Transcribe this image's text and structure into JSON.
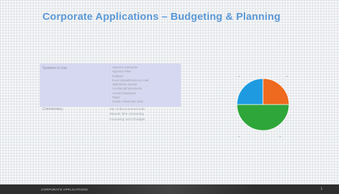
{
  "slide": {
    "title": "Corporate Applications – Budgeting & Planning",
    "table": {
      "row1": {
        "label": "Systems in Use",
        "items": [
          "Hyperion Enterprise",
          "Hyperion Pillar",
          "Essbase",
          "Excel spreadsheets & e-mail",
          "Wall-Street Journal",
          "Acrobat pdf documents",
          "Access Databases",
          "Paper",
          "Oracle e-Business Suite"
        ]
      },
      "row2": {
        "label": "Commentary",
        "lines": [
          "Mix of disconnected tools",
          "Manual, time consuming",
          "Increasing cost of budget"
        ]
      }
    },
    "pie": {
      "values": [
        50,
        25,
        25
      ],
      "colors": [
        "#2fa63a",
        "#1e9be0",
        "#ee6a1e"
      ]
    },
    "footer": {
      "left": "CORPORATE APPLICATIONS",
      "right": "1"
    }
  }
}
